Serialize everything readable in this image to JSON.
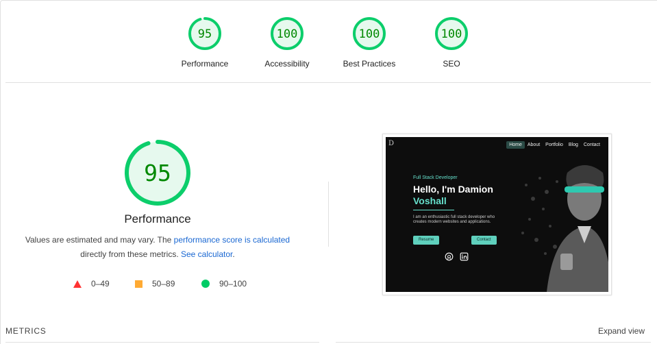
{
  "gauges": [
    {
      "score": "95",
      "label": "Performance",
      "fraction": 0.95
    },
    {
      "score": "100",
      "label": "Accessibility",
      "fraction": 1.0
    },
    {
      "score": "100",
      "label": "Best Practices",
      "fraction": 1.0
    },
    {
      "score": "100",
      "label": "SEO",
      "fraction": 1.0
    }
  ],
  "performance": {
    "score": "95",
    "fraction": 0.95,
    "title": "Performance",
    "desc_part1": "Values are estimated and may vary. The ",
    "link1": "performance score is calculated",
    "desc_part2": " directly from these metrics. ",
    "link2": "See calculator",
    "desc_part3": "."
  },
  "legend": {
    "fail": "0–49",
    "average": "50–89",
    "pass": "90–100"
  },
  "thumbnail": {
    "logo": "D",
    "nav": [
      "Home",
      "About",
      "Portfolio",
      "Blog",
      "Contact"
    ],
    "subtitle": "Full Stack Developer",
    "headline_1": "Hello, I'm Damion",
    "headline_2": "Voshall",
    "description": "I am an enthusiastic full stack developer who creates modern websites and applications.",
    "btn_resume": "Resume",
    "btn_contact": "Contact"
  },
  "metrics_label": "METRICS",
  "expand_label": "Expand view",
  "colors": {
    "pass": "#0cce6b",
    "pass_text": "#008800",
    "pass_bg": "#e6f9ee",
    "average": "#ffaa33",
    "fail": "#ff3333",
    "link": "#1967d2"
  }
}
